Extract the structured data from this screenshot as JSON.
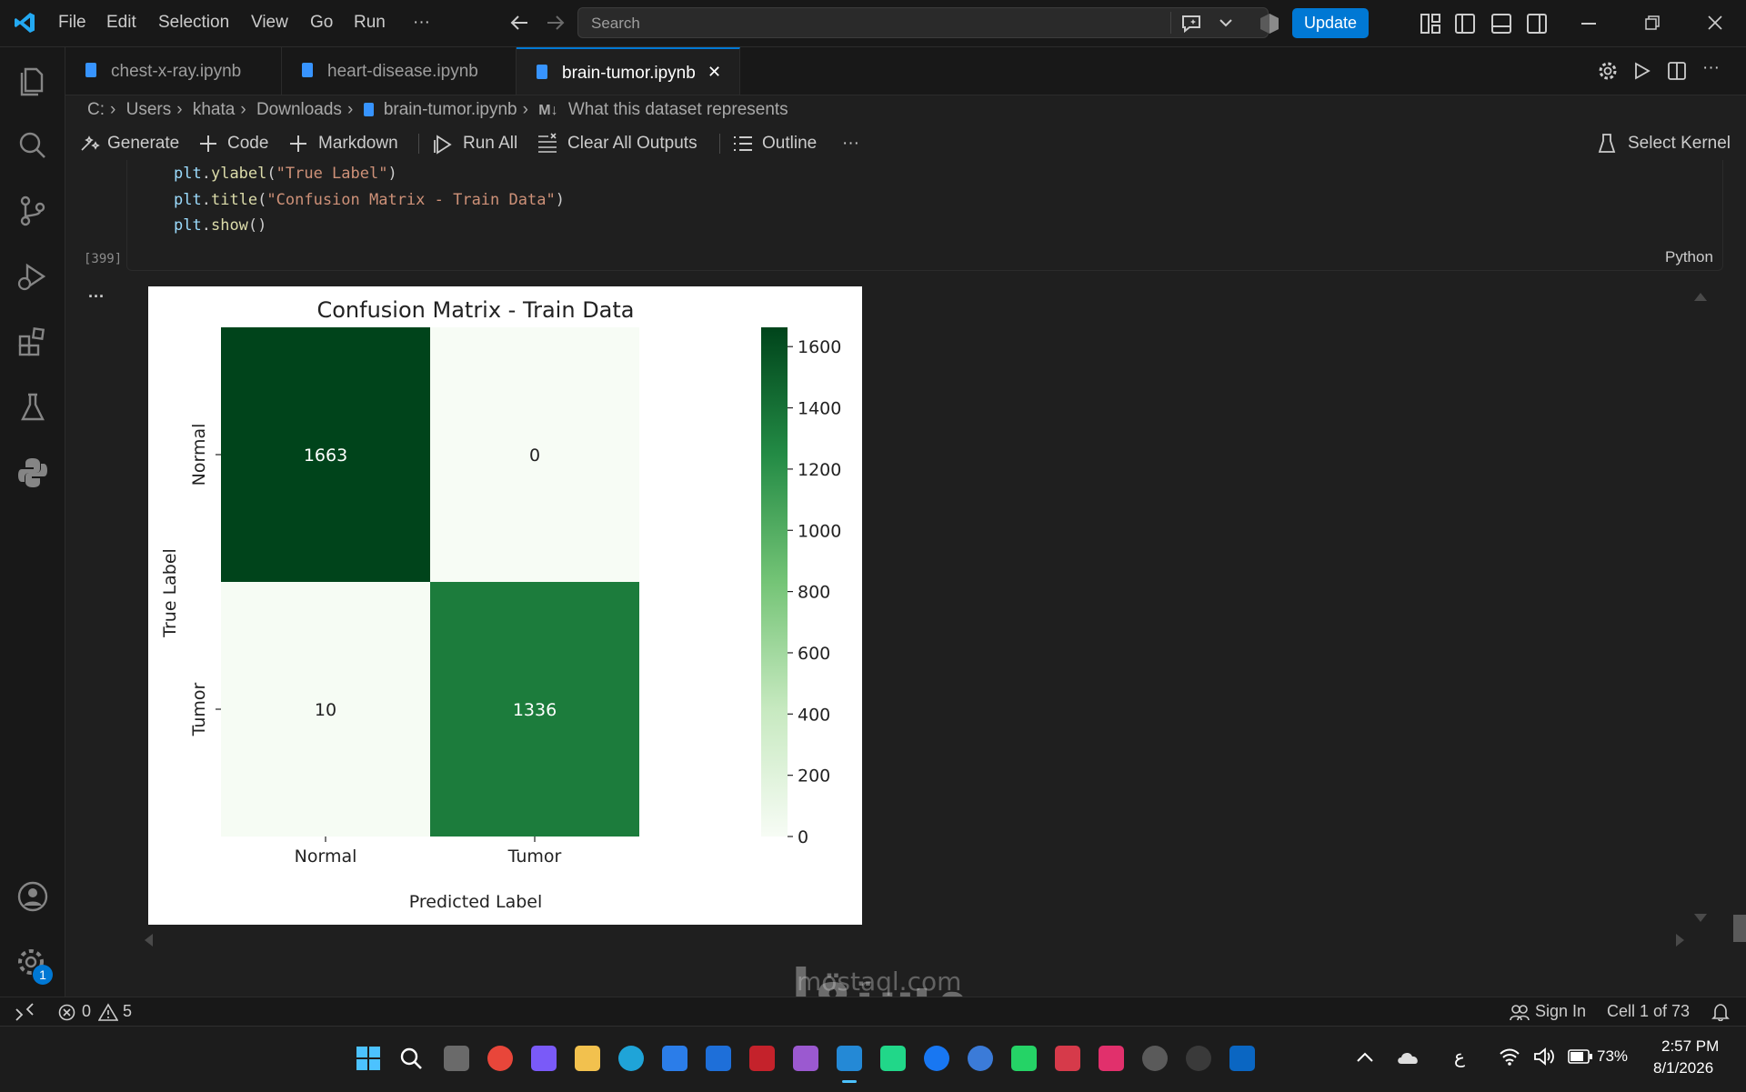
{
  "menu": {
    "file": "File",
    "edit": "Edit",
    "selection": "Selection",
    "view": "View",
    "go": "Go",
    "run": "Run",
    "more": "···"
  },
  "search": {
    "placeholder": "Search"
  },
  "update_button": "Update",
  "tabs": [
    {
      "label": "chest-x-ray.ipynb",
      "active": false
    },
    {
      "label": "heart-disease.ipynb",
      "active": false
    },
    {
      "label": "brain-tumor.ipynb",
      "active": true
    }
  ],
  "tab_close": "✕",
  "breadcrumb": {
    "drive": "C:",
    "users": "Users",
    "user": "khata",
    "folder": "Downloads",
    "file": "brain-tumor.ipynb",
    "section": "What this dataset represents",
    "md_badge": "M↓"
  },
  "toolbar": {
    "generate": "Generate",
    "code": "Code",
    "markdown": "Markdown",
    "run_all": "Run All",
    "clear_outputs": "Clear All Outputs",
    "outline": "Outline",
    "more": "···",
    "select_kernel": "Select Kernel"
  },
  "cell": {
    "exec_count": "[399]",
    "language": "Python",
    "lines": [
      [
        {
          "t": "plt",
          "c": "var"
        },
        {
          "t": ".",
          "c": "pun"
        },
        {
          "t": "ylabel",
          "c": "fn"
        },
        {
          "t": "(",
          "c": "pun"
        },
        {
          "t": "\"True Label\"",
          "c": "str"
        },
        {
          "t": ")",
          "c": "pun"
        }
      ],
      [
        {
          "t": "plt",
          "c": "var"
        },
        {
          "t": ".",
          "c": "pun"
        },
        {
          "t": "title",
          "c": "fn"
        },
        {
          "t": "(",
          "c": "pun"
        },
        {
          "t": "\"Confusion Matrix - Train Data\"",
          "c": "str"
        },
        {
          "t": ")",
          "c": "pun"
        }
      ],
      [
        {
          "t": "plt",
          "c": "var"
        },
        {
          "t": ".",
          "c": "pun"
        },
        {
          "t": "show",
          "c": "fn"
        },
        {
          "t": "()",
          "c": "pun"
        }
      ]
    ],
    "output_more": "···"
  },
  "chart_data": {
    "type": "heatmap",
    "title": "Confusion Matrix - Train Data",
    "xlabel": "Predicted Label",
    "ylabel": "True Label",
    "x_categories": [
      "Normal",
      "Tumor"
    ],
    "y_categories": [
      "Normal",
      "Tumor"
    ],
    "values": [
      [
        1663,
        0
      ],
      [
        10,
        1336
      ]
    ],
    "colormap": "Greens",
    "colorbar": {
      "min": 0,
      "max": 1663,
      "ticks": [
        0,
        200,
        400,
        600,
        800,
        1000,
        1200,
        1400,
        1600
      ]
    },
    "colors": {
      "low": "#f7fcf5",
      "high": "#00441b"
    }
  },
  "status": {
    "errors": "0",
    "warnings": "5",
    "sign_in": "Sign In",
    "cell_pos": "Cell 1 of 73",
    "notif_badge": "1"
  },
  "taskbar": {
    "arabic": "ع",
    "battery": "73%",
    "time": "2:57 PM",
    "date": "8/1/2026"
  },
  "watermark": {
    "arabic": "مستقل",
    "latin": "mostaql.com"
  }
}
